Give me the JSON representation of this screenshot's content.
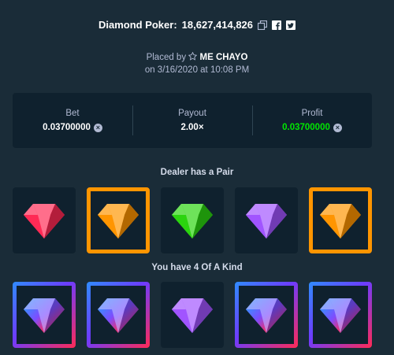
{
  "header": {
    "game": "Diamond Poker:",
    "bet_id": "18,627,414,826"
  },
  "placed": {
    "prefix": "Placed by",
    "user": "ME CHAYO",
    "date": "on 3/16/2020 at 10:08 PM"
  },
  "stats": {
    "bet_label": "Bet",
    "bet_value": "0.03700000",
    "payout_label": "Payout",
    "payout_value": "2.00×",
    "profit_label": "Profit",
    "profit_value": "0.03700000"
  },
  "dealer": {
    "title": "Dealer has a Pair",
    "gems": [
      {
        "color": "red",
        "highlight": "none"
      },
      {
        "color": "orange",
        "highlight": "orange"
      },
      {
        "color": "green",
        "highlight": "none"
      },
      {
        "color": "purple",
        "highlight": "none"
      },
      {
        "color": "orange",
        "highlight": "orange"
      }
    ]
  },
  "player": {
    "title": "You have 4 Of A Kind",
    "gems": [
      {
        "color": "multi",
        "highlight": "multi"
      },
      {
        "color": "multi",
        "highlight": "multi"
      },
      {
        "color": "purple",
        "highlight": "none"
      },
      {
        "color": "multi",
        "highlight": "multi"
      },
      {
        "color": "multi",
        "highlight": "multi"
      }
    ]
  },
  "colors": {
    "red": "#ff2a55",
    "orange": "#ff9500",
    "green": "#2bd40f",
    "purple": "#a154ff",
    "profit": "#00e701"
  },
  "icons": [
    "copy-icon",
    "facebook-icon",
    "twitter-icon",
    "star-icon",
    "currency-icon"
  ]
}
